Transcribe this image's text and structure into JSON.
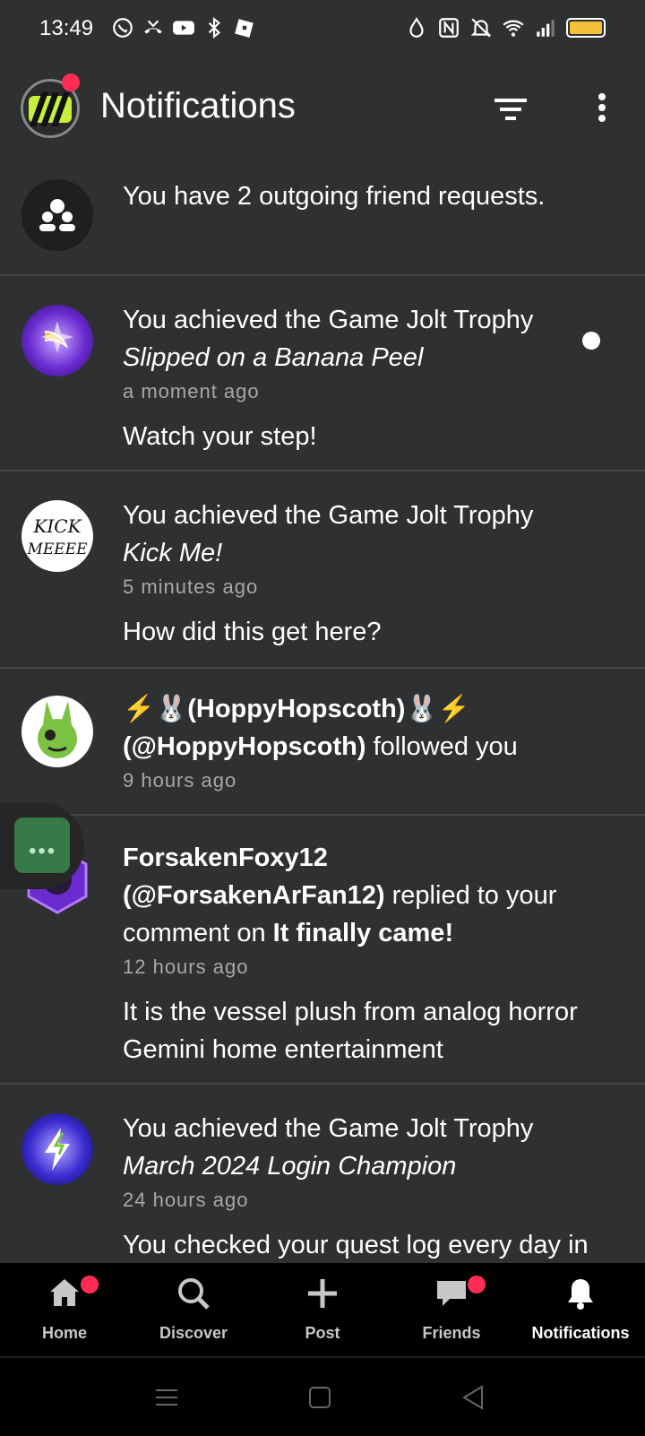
{
  "status_bar": {
    "time": "13:49",
    "left_icons": [
      "whatsapp-icon",
      "missed-call-icon",
      "youtube-icon",
      "bluetooth-icon",
      "roblox-icon"
    ],
    "right_icons": [
      "data-saver-icon",
      "nfc-icon",
      "mute-icon",
      "wifi-icon",
      "signal-icon",
      "battery-icon"
    ],
    "battery_color": "#f3c03a"
  },
  "header": {
    "title": "Notifications"
  },
  "notifications": [
    {
      "text": "You have 2 outgoing friend requests."
    },
    {
      "prefix": "You achieved the Game Jolt Trophy",
      "trophy": "Slipped on a Banana Peel",
      "time": "a moment ago",
      "description": "Watch your step!",
      "unread": true
    },
    {
      "prefix": "You achieved the Game Jolt Trophy",
      "trophy": "Kick Me!",
      "time": "5 minutes ago",
      "description": "How did this get here?",
      "avatar_text_1": "KICK",
      "avatar_text_2": "MEEEE"
    },
    {
      "name": "⚡🐰(HoppyHopscoth)🐰⚡",
      "handle": "(@HoppyHopscoth)",
      "action": "followed you",
      "time": "9 hours ago"
    },
    {
      "name": "ForsakenFoxy12",
      "handle": "(@ForsakenArFan12)",
      "action": "replied to your comment on",
      "post": "It finally came!",
      "time": "12 hours ago",
      "description": "It is the vessel plush from analog horror Gemini home entertainment"
    },
    {
      "prefix": "You achieved the Game Jolt Trophy",
      "trophy": "March 2024 Login Champion",
      "time": "24 hours ago",
      "description": "You checked your quest log every day in"
    }
  ],
  "tabs": [
    {
      "label": "Home",
      "badge": true
    },
    {
      "label": "Discover",
      "badge": false
    },
    {
      "label": "Post",
      "badge": false
    },
    {
      "label": "Friends",
      "badge": true
    },
    {
      "label": "Notifications",
      "badge": false,
      "active": true
    }
  ],
  "colors": {
    "background": "#2f3031",
    "badge": "#ff2d55",
    "brand_green": "#c6f03b",
    "tabbar": "#000000"
  }
}
